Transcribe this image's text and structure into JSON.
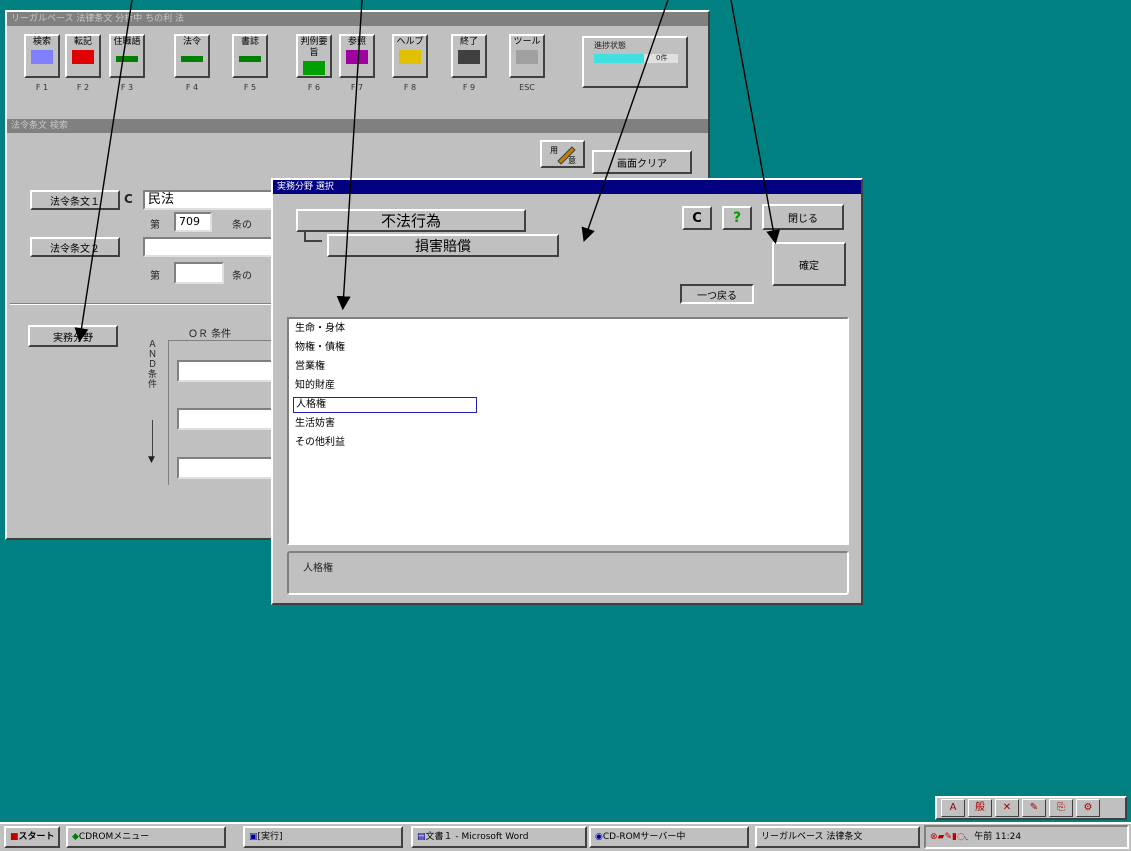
{
  "background_color": "#008080",
  "main_window": {
    "title": "リーガルベース 法律条文 分析中 ちの利 法",
    "toolbar": [
      {
        "label": "検索",
        "fkey": "F 1",
        "icon": "search-grid-icon"
      },
      {
        "label": "転記",
        "fkey": "F 2",
        "icon": "transfer-icon"
      },
      {
        "label": "住職語",
        "fkey": "F 3",
        "icon": "green-bar-icon"
      },
      {
        "label": "法令",
        "fkey": "F 4",
        "icon": "green-bar-icon"
      },
      {
        "label": "書誌",
        "fkey": "F 5",
        "icon": "green-bar-icon"
      },
      {
        "label": "判例要旨",
        "fkey": "F 6",
        "icon": "new-icon"
      },
      {
        "label": "参照",
        "fkey": "F 7",
        "icon": "reference-icon"
      },
      {
        "label": "ヘルプ",
        "fkey": "F 8",
        "icon": "help-icon"
      },
      {
        "label": "終了",
        "fkey": "F 9",
        "icon": "exit-door-icon"
      },
      {
        "label": "ツール",
        "fkey": "ESC",
        "icon": "tool-icon"
      }
    ],
    "progress": {
      "label": "進捗状態",
      "percent_label": "0件",
      "fraction": 0.6
    },
    "subtitle": "法令条文 検索",
    "memo_button_icon": "memo-pen-icon",
    "clear_button": "画面クリア",
    "law1_button": "法令条文１",
    "law1_c": "C",
    "law1_value": "民法",
    "law1_article_prefix": "第",
    "law1_article_value": "709",
    "law1_article_suffix": "条の",
    "law2_button": "法令条文２",
    "law2_value": "",
    "law2_article_prefix": "第",
    "law2_article_value": "",
    "law2_article_suffix": "条の",
    "field_button": "実務分野",
    "or_label": "ＯＲ 条件",
    "and_label": "ＡＮＤ条件"
  },
  "dialog": {
    "title": "実務分野 選択",
    "level1": "不法行為",
    "level2": "損害賠償",
    "c_button": "C",
    "help_icon": "question-icon",
    "close_button": "閉じる",
    "confirm_button": "確定",
    "back_button": "一つ戻る",
    "list": [
      "生命・身体",
      "物権・債権",
      "営業権",
      "知的財産",
      "人格権",
      "生活妨害",
      "その他利益"
    ],
    "selected_index": 4,
    "result": "人格権"
  },
  "tray_toolbar": [
    "A",
    "般",
    "✕",
    "✎",
    "⎘",
    "⚙"
  ],
  "taskbar": {
    "start": "スタート",
    "tasks": [
      "CDROMメニュー",
      "[実行]",
      "文書１ - Microsoft Word",
      "CD-ROMサーバー中",
      "リーガルベース 法律条文"
    ],
    "clock": "午前 11:24"
  }
}
